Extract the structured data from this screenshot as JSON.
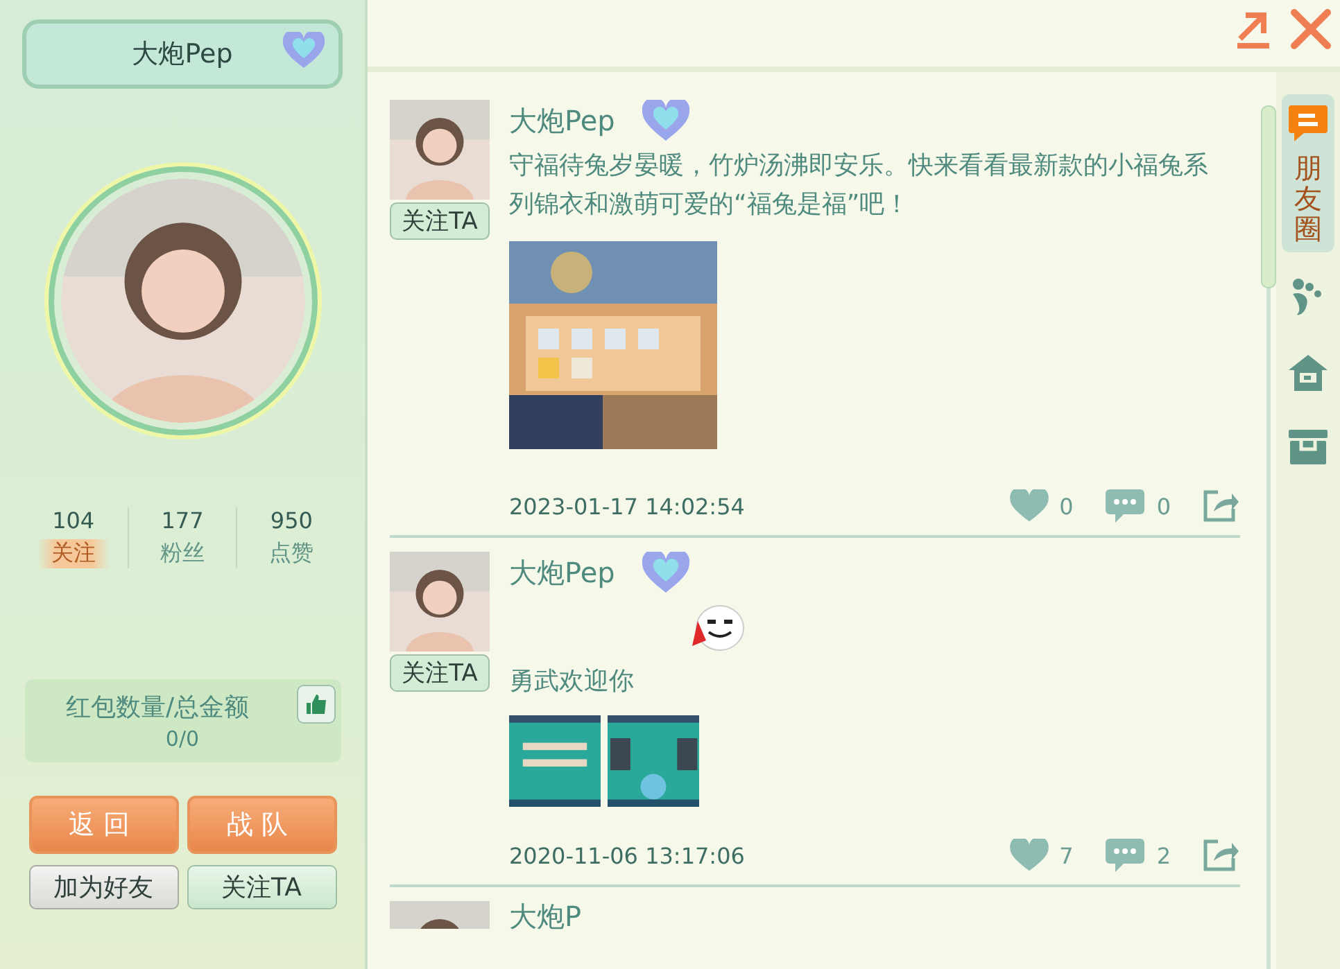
{
  "profile": {
    "name": "大炮Pep",
    "stats": [
      {
        "value": "104",
        "label": "关注",
        "selected": true
      },
      {
        "value": "177",
        "label": "粉丝",
        "selected": false
      },
      {
        "value": "950",
        "label": "点赞",
        "selected": false
      }
    ],
    "red_packet": {
      "label": "红包数量/总金额",
      "value": "0/0"
    },
    "buttons": [
      {
        "label": "返回",
        "kind": "primary"
      },
      {
        "label": "战队",
        "kind": "primary"
      },
      {
        "label": "加为好友",
        "kind": "grey"
      },
      {
        "label": "关注TA",
        "kind": "green"
      }
    ]
  },
  "posts": [
    {
      "name": "大炮Pep",
      "follow": "关注TA",
      "sticker": false,
      "text": "守福待兔岁晏暖，竹炉汤沸即安乐。快来看看最新款的小福兔系列锦衣和激萌可爱的“福兔是福”吧！",
      "time": "2023-01-17 14:02:54",
      "likes": "0",
      "comments": "0"
    },
    {
      "name": "大炮Pep",
      "follow": "关注TA",
      "sticker": true,
      "text": "勇武欢迎你",
      "time": "2020-11-06 13:17:06",
      "likes": "7",
      "comments": "2"
    }
  ],
  "next_post": {
    "name": "大炮P"
  },
  "side_tabs": [
    {
      "kind": "moments",
      "label": "朋友圈",
      "selected": true
    },
    {
      "kind": "paw",
      "selected": false
    },
    {
      "kind": "home",
      "selected": false
    },
    {
      "kind": "box",
      "selected": false
    }
  ]
}
